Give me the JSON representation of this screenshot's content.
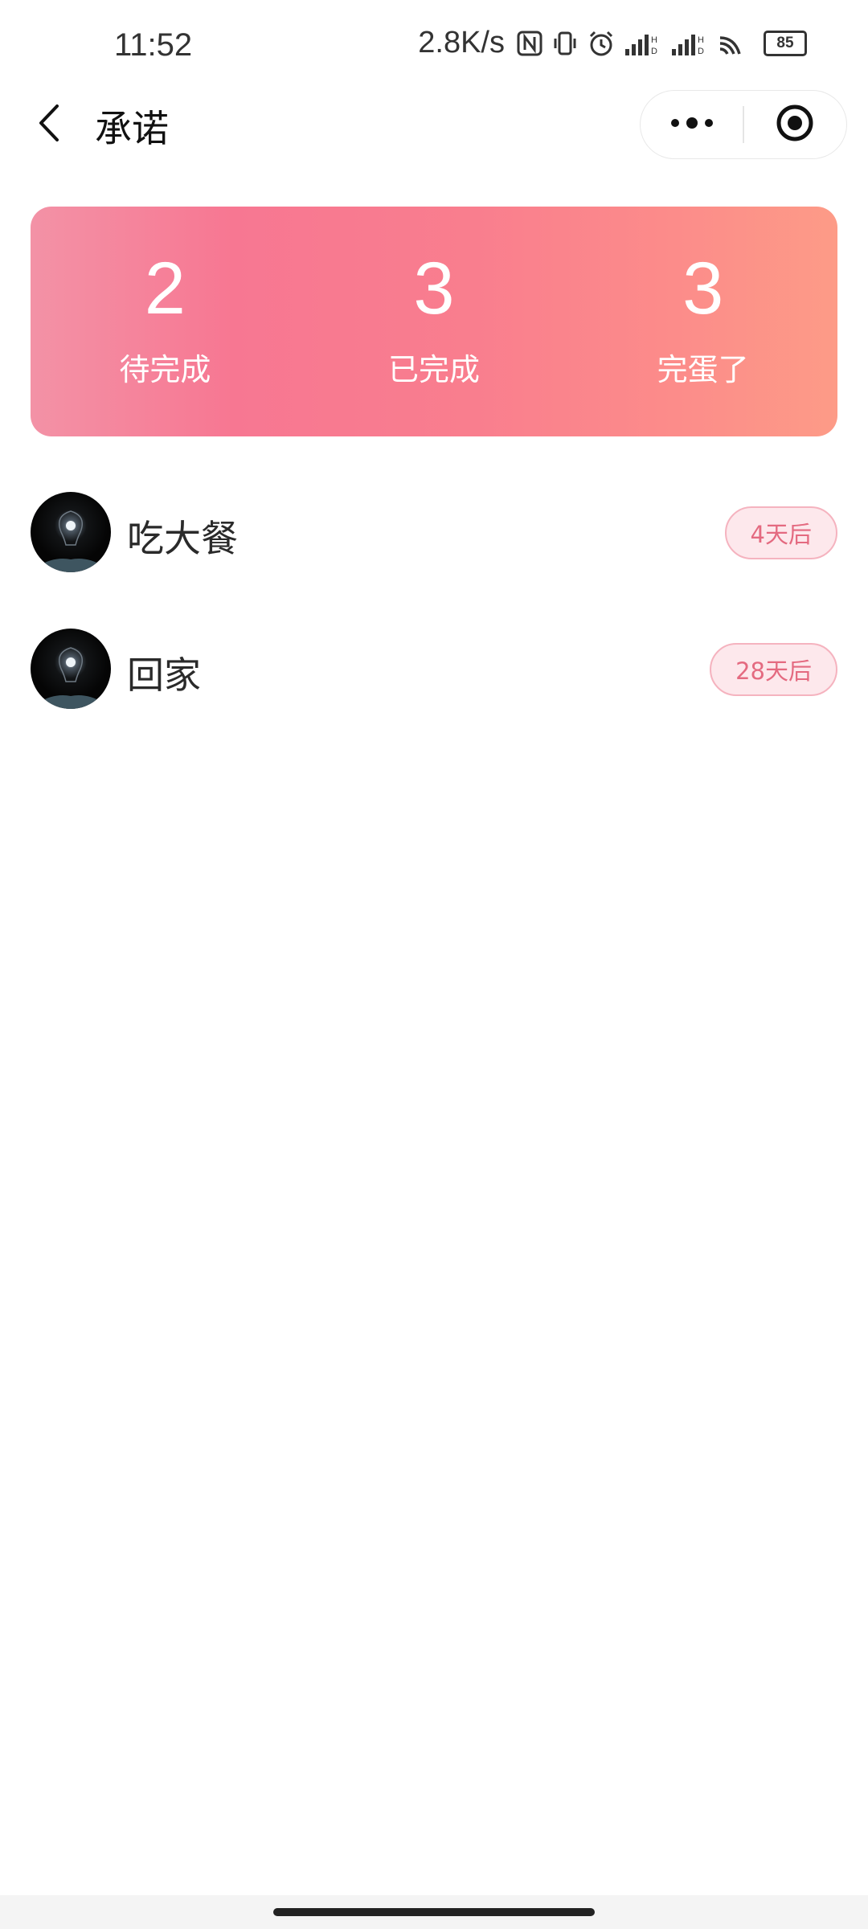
{
  "status_bar": {
    "time": "11:52",
    "net_speed": "2.8K/s",
    "battery": "85",
    "icons": [
      "nfc-icon",
      "vibrate-icon",
      "alarm-icon",
      "signal-hd-icon",
      "signal-hd-icon",
      "wifi-icon",
      "battery-icon"
    ]
  },
  "nav": {
    "title": "承诺",
    "back_icon": "chevron-left-icon",
    "more_icon": "more-dots-icon",
    "close_icon": "target-circle-icon"
  },
  "stats": [
    {
      "value": "2",
      "label": "待完成"
    },
    {
      "value": "3",
      "label": "已完成"
    },
    {
      "value": "3",
      "label": "完蛋了"
    }
  ],
  "promises": [
    {
      "title": "吃大餐",
      "days": "4天后"
    },
    {
      "title": "回家",
      "days": "28天后"
    }
  ],
  "colors": {
    "card_gradient_start": "#f392a6",
    "card_gradient_end": "#fd9b87",
    "badge_text": "#e46a80",
    "badge_bg": "#fde8ec",
    "badge_border": "#f5b3bf"
  }
}
